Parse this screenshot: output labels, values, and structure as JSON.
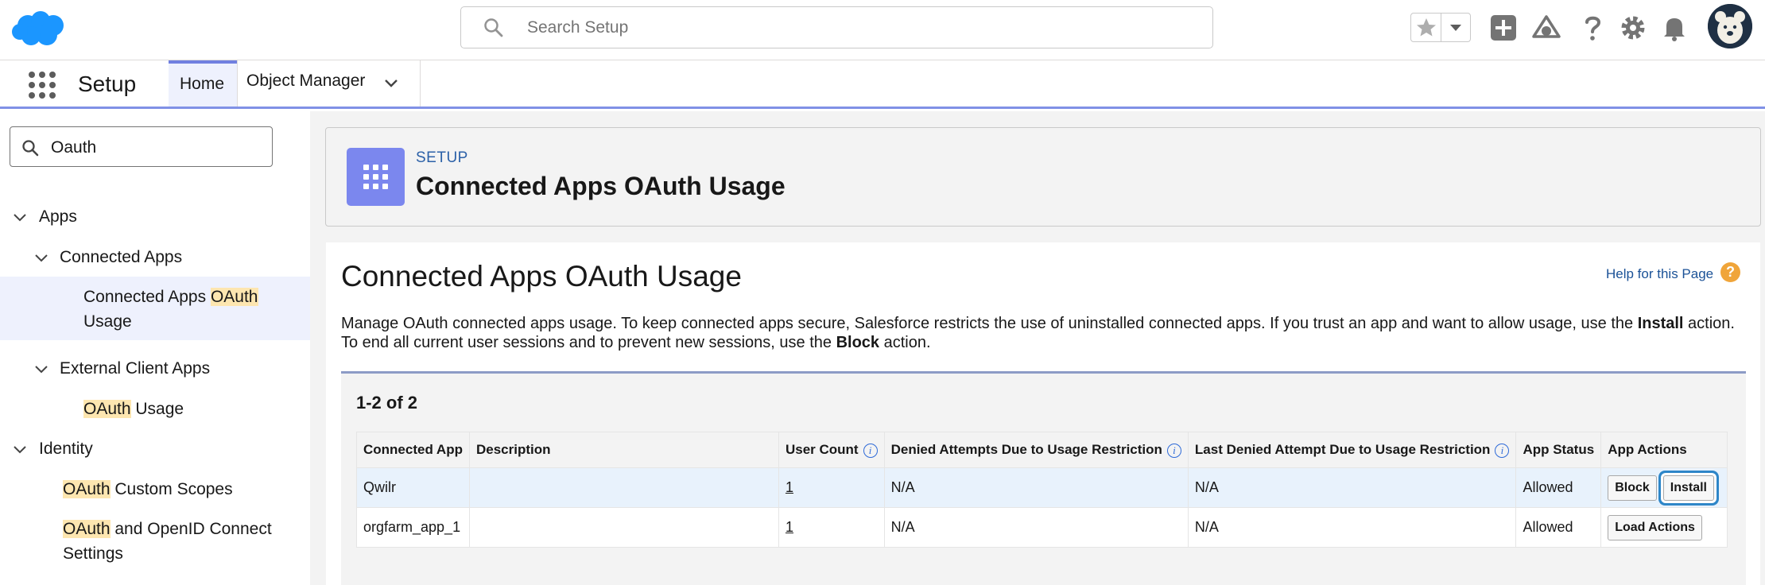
{
  "header": {
    "search_placeholder": "Search Setup",
    "icons": [
      "salesforce-cloud-logo",
      "search-icon",
      "star-icon",
      "chevron-down-icon",
      "add-icon",
      "trailhead-icon",
      "help-icon",
      "gear-icon",
      "bell-icon",
      "avatar"
    ]
  },
  "context_bar": {
    "app_name": "Setup",
    "tabs": [
      {
        "label": "Home",
        "active": true
      },
      {
        "label": "Object Manager",
        "active": false
      }
    ]
  },
  "sidebar": {
    "quickfind_value": "Oauth",
    "tree": {
      "apps": "Apps",
      "connected_apps": "Connected Apps",
      "connected_apps_oauth_usage_prefix": "Connected Apps ",
      "connected_apps_oauth_usage_hl": "OAuth",
      "connected_apps_oauth_usage_suffix": "Usage",
      "external_client_apps": "External Client Apps",
      "oauth_usage_hl": "OAuth",
      "oauth_usage_suffix": " Usage",
      "identity": "Identity",
      "oauth_custom_scopes_hl": "OAuth",
      "oauth_custom_scopes_suffix": " Custom Scopes",
      "oauth_openid_hl": "OAuth",
      "oauth_openid_suffix": " and OpenID Connect",
      "oauth_openid_line2": "Settings"
    }
  },
  "page_header": {
    "eyebrow": "SETUP",
    "title": "Connected Apps OAuth Usage"
  },
  "content": {
    "title": "Connected Apps OAuth Usage",
    "help_link": "Help for this Page",
    "description_1": "Manage OAuth connected apps usage. To keep connected apps secure, Salesforce restricts the use of uninstalled connected apps. If you trust an app and want to allow usage, use the ",
    "description_install": "Install",
    "description_2": " action. To end all current user sessions and to prevent new sessions, use the ",
    "description_block": "Block",
    "description_3": " action.",
    "count": "1-2 of 2",
    "columns": {
      "connected_app": "Connected App",
      "description": "Description",
      "user_count": "User Count",
      "denied_attempts": "Denied Attempts Due to Usage Restriction",
      "last_denied": "Last Denied Attempt Due to Usage Restriction",
      "app_status": "App Status",
      "app_actions": "App Actions"
    },
    "rows": [
      {
        "app": "Qwilr",
        "description": "",
        "user_count": "1",
        "denied": "N/A",
        "last_denied": "N/A",
        "status": "Allowed",
        "actions": [
          "Block",
          "Install"
        ]
      },
      {
        "app": "orgfarm_app_1",
        "description": "",
        "user_count": "1",
        "denied": "N/A",
        "last_denied": "N/A",
        "status": "Allowed",
        "actions": [
          "Load Actions"
        ]
      }
    ]
  }
}
